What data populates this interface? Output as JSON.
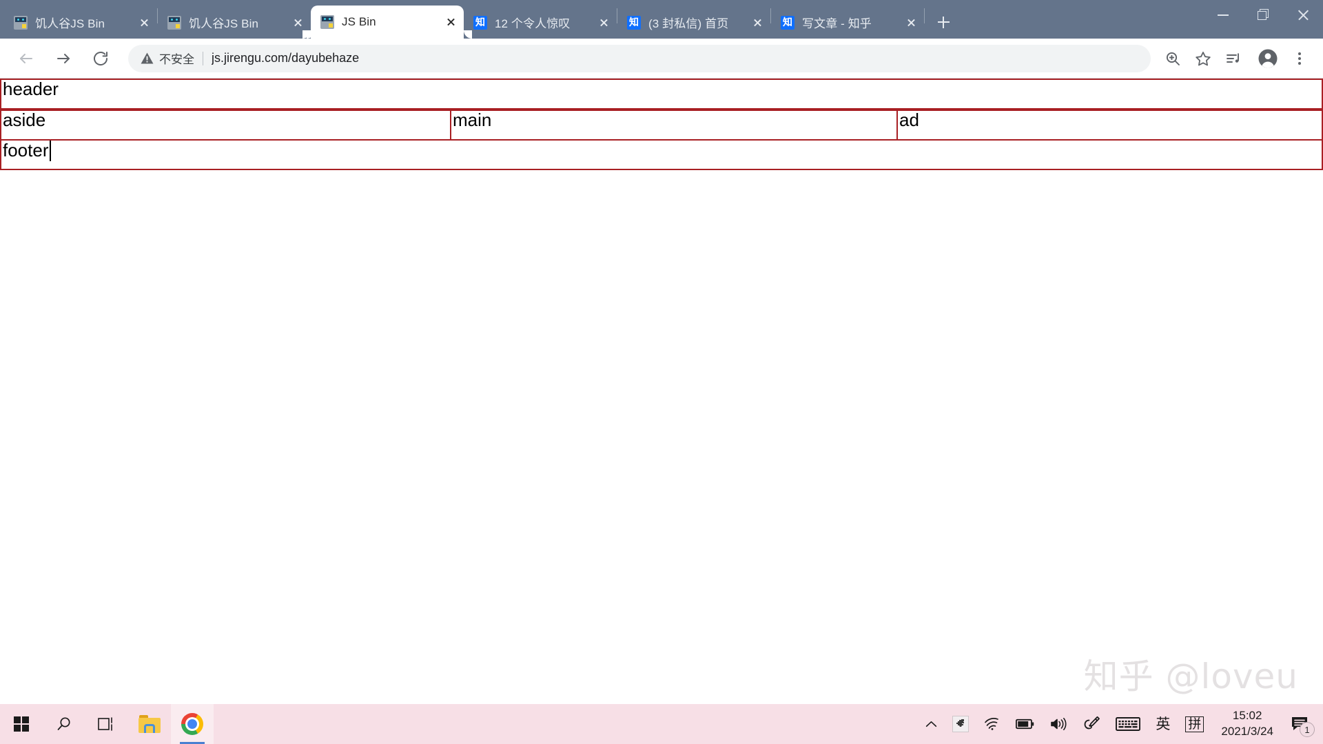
{
  "browser": {
    "tabs": [
      {
        "title": "饥人谷JS Bin",
        "favicon": "jsbin-icon",
        "active": false
      },
      {
        "title": "饥人谷JS Bin",
        "favicon": "jsbin-icon",
        "active": false
      },
      {
        "title": "JS Bin",
        "favicon": "jsbin-icon",
        "active": true
      },
      {
        "title": "12 个令人惊叹",
        "favicon": "zhihu-icon",
        "active": false
      },
      {
        "title": "(3 封私信) 首页",
        "favicon": "zhihu-icon",
        "active": false
      },
      {
        "title": "写文章 - 知乎",
        "favicon": "zhihu-icon",
        "active": false
      }
    ],
    "new_tab_label": "+",
    "window_controls": {
      "minimize": "Minimize",
      "restore": "Restore",
      "close": "Close"
    },
    "toolbar": {
      "back": "Back",
      "forward": "Forward",
      "reload": "Reload",
      "security_text": "不安全",
      "url": "js.jirengu.com/dayubehaze",
      "url_host": "js.jirengu.com",
      "url_path": "/dayubehaze",
      "zoom_icon": "zoom-in-icon",
      "bookmark_icon": "star-icon",
      "media_icon": "media-list-icon",
      "profile_icon": "avatar-icon",
      "menu_icon": "three-dot-menu-icon"
    },
    "tab_strip_color": "#64748b"
  },
  "page": {
    "blocks": {
      "header": "header",
      "aside": "aside",
      "main": "main",
      "ad": "ad",
      "footer": "footer"
    },
    "border_color": "#a81f23"
  },
  "watermark": "知乎 @loveu",
  "taskbar": {
    "background": "#f7dfe6",
    "apps": [
      {
        "name": "start-button",
        "label": "Start"
      },
      {
        "name": "search-button",
        "label": "Search"
      },
      {
        "name": "task-view-button",
        "label": "Task View"
      },
      {
        "name": "file-explorer-button",
        "label": "File Explorer"
      },
      {
        "name": "chrome-button",
        "label": "Google Chrome",
        "active": true
      }
    ],
    "tray": {
      "overflow": "show-hidden-icons",
      "dino": "dino-icon",
      "wifi": "wifi-icon",
      "battery": "battery-icon",
      "volume": "volume-icon",
      "pen": "pen-icon",
      "keyboard": "keyboard-icon",
      "ime_language": "英",
      "ime_mode": "拼"
    },
    "clock": {
      "time": "15:02",
      "date": "2021/3/24"
    },
    "notifications": {
      "icon": "notification-icon",
      "count": "1"
    }
  }
}
